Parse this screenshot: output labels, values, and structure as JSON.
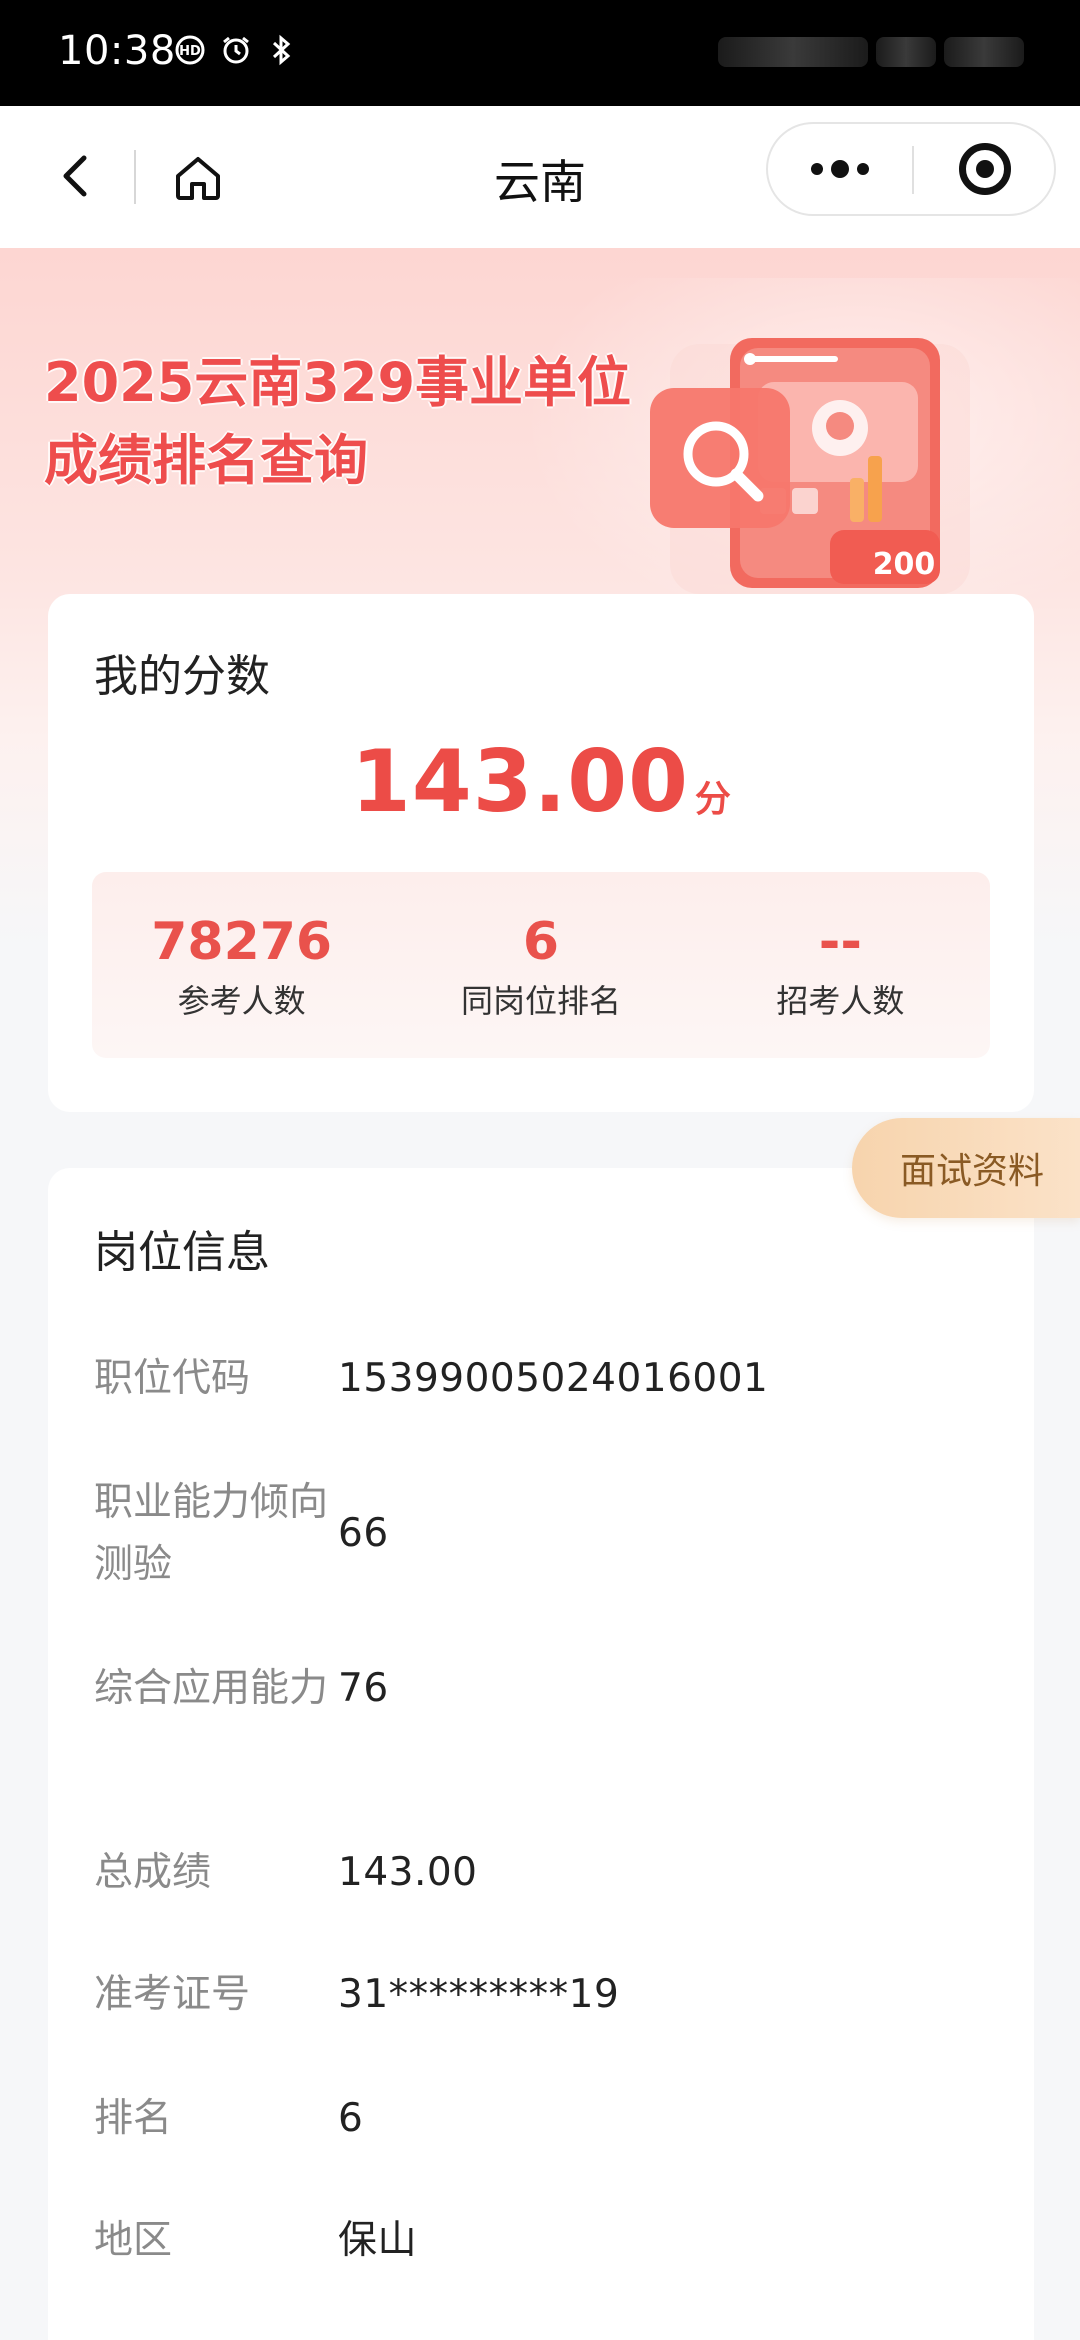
{
  "status_bar": {
    "time": "10:38",
    "icons": [
      "hd-call-icon",
      "alarm-icon",
      "bluetooth-icon"
    ]
  },
  "nav": {
    "title": "云南"
  },
  "hero": {
    "title_line1": "2025云南329事业单位",
    "title_line2": "成绩排名查询",
    "badge": "200"
  },
  "score_card": {
    "title": "我的分数",
    "score": "143.00",
    "unit": "分",
    "stats": [
      {
        "value": "78276",
        "label": "参考人数"
      },
      {
        "value": "6",
        "label": "同岗位排名"
      },
      {
        "value": "--",
        "label": "招考人数"
      }
    ]
  },
  "float_tab": {
    "label": "面试资料"
  },
  "info_card": {
    "title": "岗位信息",
    "rows": [
      {
        "label": "职位代码",
        "value": "15399005024016001"
      },
      {
        "label": "职业能力倾向测验",
        "value": "66"
      },
      {
        "label": "综合应用能力",
        "value": "76"
      },
      {
        "label": "总成绩",
        "value": "143.00"
      },
      {
        "label": "准考证号",
        "value": "31*********19"
      },
      {
        "label": "排名",
        "value": "6"
      },
      {
        "label": "地区",
        "value": "保山"
      }
    ]
  },
  "colors": {
    "accent": "#ec4c47",
    "tab_text": "#8a5a24",
    "label_gray": "#8a8a8a"
  }
}
